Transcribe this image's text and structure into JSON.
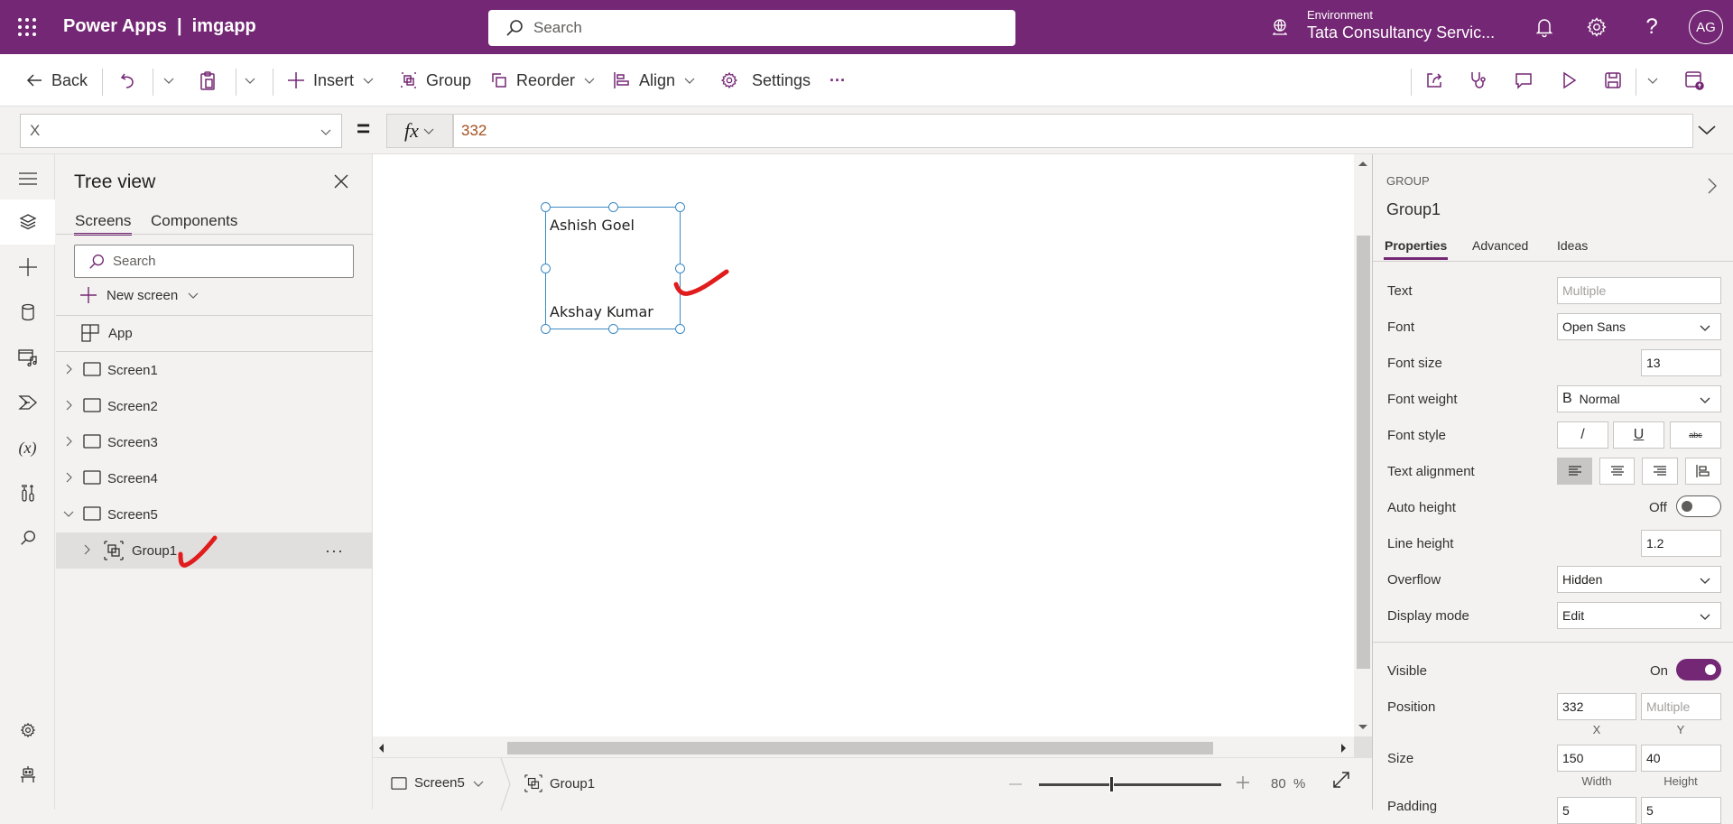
{
  "topbar": {
    "app_title": "Power Apps  |  imgapp",
    "search_placeholder": "Search",
    "environment_label": "Environment",
    "environment_name": "Tata Consultancy Servic...",
    "avatar_initials": "AG",
    "brand_color": "#742774"
  },
  "commandbar": {
    "back": "Back",
    "insert": "Insert",
    "group": "Group",
    "reorder": "Reorder",
    "align": "Align",
    "settings": "Settings",
    "more": "···"
  },
  "formula_bar": {
    "property": "X",
    "equals": "=",
    "fx_label": "fx",
    "formula": "332"
  },
  "tree_view": {
    "title": "Tree view",
    "tabs": [
      {
        "label": "Screens",
        "active": true
      },
      {
        "label": "Components",
        "active": false
      }
    ],
    "search_placeholder": "Search",
    "new_screen": "New screen",
    "app_label": "App",
    "items": [
      {
        "label": "Screen1",
        "expanded": false
      },
      {
        "label": "Screen2",
        "expanded": false
      },
      {
        "label": "Screen3",
        "expanded": false
      },
      {
        "label": "Screen4",
        "expanded": false
      },
      {
        "label": "Screen5",
        "expanded": true
      }
    ],
    "selected_child": {
      "label": "Group1",
      "more": "···"
    }
  },
  "canvas": {
    "labels": [
      "Ashish Goel",
      "Akshay Kumar"
    ]
  },
  "statusbar": {
    "screen": "Screen5",
    "control": "Group1",
    "zoom_value": "80",
    "zoom_unit": "%",
    "zoom_fraction": 0.4
  },
  "properties": {
    "type": "GROUP",
    "name": "Group1",
    "tabs": [
      {
        "label": "Properties",
        "active": true
      },
      {
        "label": "Advanced",
        "active": false
      },
      {
        "label": "Ideas",
        "active": false
      }
    ],
    "text_label": "Text",
    "text_value": "Multiple",
    "font_label": "Font",
    "font_value": "Open Sans",
    "font_size_label": "Font size",
    "font_size_value": "13",
    "font_weight_label": "Font weight",
    "font_weight_icon": "B",
    "font_weight_value": "Normal",
    "font_style_label": "Font style",
    "italic": "/",
    "underline": "U",
    "strike": "abc",
    "text_alignment_label": "Text alignment",
    "auto_height_label": "Auto height",
    "auto_height_value": "Off",
    "line_height_label": "Line height",
    "line_height_value": "1.2",
    "overflow_label": "Overflow",
    "overflow_value": "Hidden",
    "display_mode_label": "Display mode",
    "display_mode_value": "Edit",
    "visible_label": "Visible",
    "visible_value": "On",
    "position_label": "Position",
    "x_value": "332",
    "y_value": "Multiple",
    "x_caption": "X",
    "y_caption": "Y",
    "size_label": "Size",
    "width_value": "150",
    "height_value": "40",
    "width_caption": "Width",
    "height_caption": "Height",
    "padding_label": "Padding",
    "padding_top": "5",
    "padding_bottom": "5"
  }
}
